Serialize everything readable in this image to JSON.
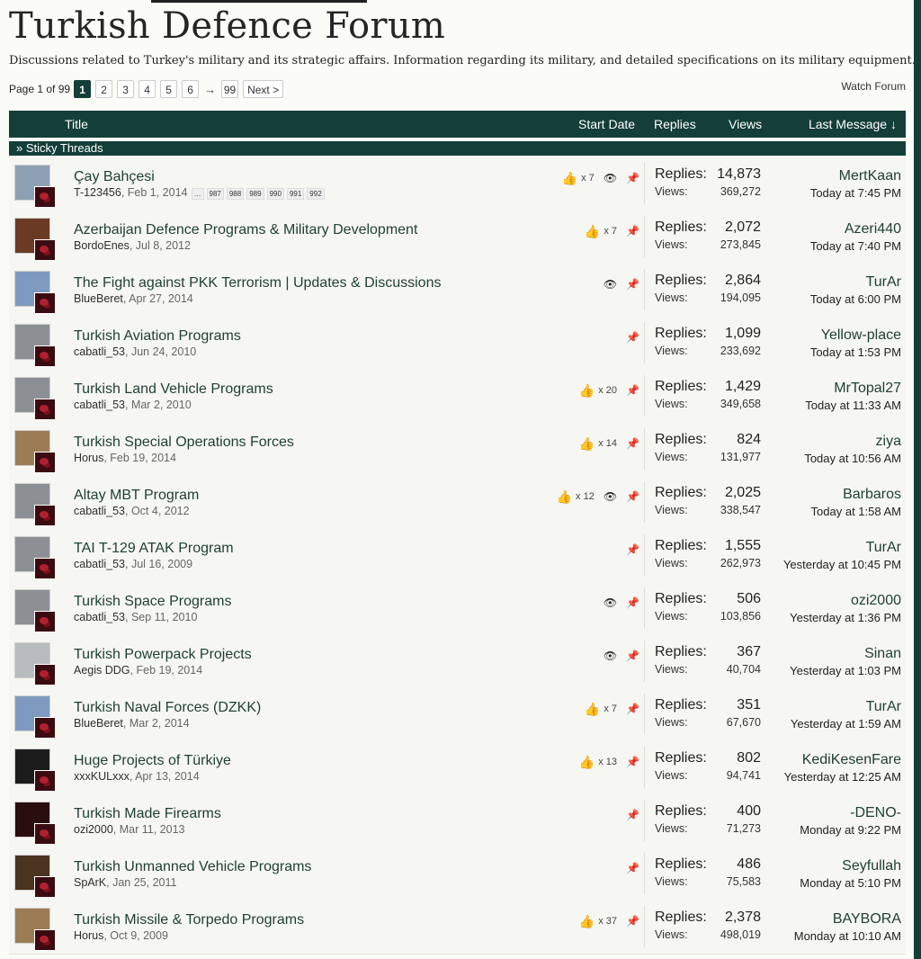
{
  "forum": {
    "title": "Turkish Defence Forum",
    "description": "Discussions related to Turkey's military and its strategic affairs. Information regarding its military, and detailed specifications on its military equipment."
  },
  "pagination": {
    "label": "Page 1 of 99",
    "current": "1",
    "pages": [
      "2",
      "3",
      "4",
      "5",
      "6"
    ],
    "arrow": "→",
    "last": "99",
    "next": "Next >"
  },
  "watch_label": "Watch Forum",
  "columns": {
    "title": "Title",
    "start_date": "Start Date",
    "replies": "Replies",
    "views": "Views",
    "last_message": "Last Message ↓"
  },
  "sticky_label": "» Sticky Threads",
  "row_labels": {
    "replies": "Replies:",
    "views": "Views:"
  },
  "colors": {
    "header": "#143f38",
    "title_link": "#1e3f35",
    "like": "#d49a4c"
  },
  "threads": [
    {
      "title": "Çay Bahçesi",
      "author": "T-123456",
      "date": ", Feb 1, 2014",
      "pages": [
        "…",
        "987",
        "988",
        "989",
        "990",
        "991",
        "992"
      ],
      "likes": "x 7",
      "watched": true,
      "sticky": true,
      "replies": "14,873",
      "views": "369,272",
      "last_user": "MertKaan",
      "last_time": "Today at 7:45 PM",
      "avatar_color": "#8ea0b3"
    },
    {
      "title": "Azerbaijan Defence Programs & Military Development",
      "author": "BordoEnes",
      "date": ", Jul 8, 2012",
      "likes": "x 7",
      "watched": false,
      "sticky": true,
      "replies": "2,072",
      "views": "273,845",
      "last_user": "Azeri440",
      "last_time": "Today at 7:40 PM",
      "avatar_color": "#6b3a25"
    },
    {
      "title": "The Fight against PKK Terrorism | Updates & Discussions",
      "author": "BlueBeret",
      "date": ", Apr 27, 2014",
      "likes": "",
      "watched": true,
      "sticky": true,
      "replies": "2,864",
      "views": "194,095",
      "last_user": "TurAr",
      "last_time": "Today at 6:00 PM",
      "avatar_color": "#7e9bbf"
    },
    {
      "title": "Turkish Aviation Programs",
      "author": "cabatli_53",
      "date": ", Jun 24, 2010",
      "likes": "",
      "watched": false,
      "sticky": true,
      "replies": "1,099",
      "views": "233,692",
      "last_user": "Yellow-place",
      "last_time": "Today at 1:53 PM",
      "avatar_color": "#8c8f94"
    },
    {
      "title": "Turkish Land Vehicle Programs",
      "author": "cabatli_53",
      "date": ", Mar 2, 2010",
      "likes": "x 20",
      "watched": false,
      "sticky": true,
      "replies": "1,429",
      "views": "349,658",
      "last_user": "MrTopal27",
      "last_time": "Today at 11:33 AM",
      "avatar_color": "#8c8f94"
    },
    {
      "title": "Turkish Special Operations Forces",
      "author": "Horus",
      "date": ", Feb 19, 2014",
      "likes": "x 14",
      "watched": false,
      "sticky": true,
      "replies": "824",
      "views": "131,977",
      "last_user": "ziya",
      "last_time": "Today at 10:56 AM",
      "avatar_color": "#9c7c55"
    },
    {
      "title": "Altay MBT Program",
      "author": "cabatli_53",
      "date": ", Oct 4, 2012",
      "likes": "x 12",
      "watched": true,
      "sticky": true,
      "replies": "2,025",
      "views": "338,547",
      "last_user": "Barbaros",
      "last_time": "Today at 1:58 AM",
      "avatar_color": "#8c8f94"
    },
    {
      "title": "TAI T-129 ATAK Program",
      "author": "cabatli_53",
      "date": ", Jul 16, 2009",
      "likes": "",
      "watched": false,
      "sticky": true,
      "replies": "1,555",
      "views": "262,973",
      "last_user": "TurAr",
      "last_time": "Yesterday at 10:45 PM",
      "avatar_color": "#8c8f94"
    },
    {
      "title": "Turkish Space Programs",
      "author": "cabatli_53",
      "date": ", Sep 11, 2010",
      "likes": "",
      "watched": true,
      "sticky": true,
      "replies": "506",
      "views": "103,856",
      "last_user": "ozi2000",
      "last_time": "Yesterday at 1:36 PM",
      "avatar_color": "#8c8f94"
    },
    {
      "title": "Turkish Powerpack Projects",
      "author": "Aegis DDG",
      "date": ", Feb 19, 2014",
      "likes": "",
      "watched": true,
      "sticky": true,
      "replies": "367",
      "views": "40,704",
      "last_user": "Sinan",
      "last_time": "Yesterday at 1:03 PM",
      "avatar_color": "#b8bcbe"
    },
    {
      "title": "Turkish Naval Forces (DZKK)",
      "author": "BlueBeret",
      "date": ", Mar 2, 2014",
      "likes": "x 7",
      "watched": false,
      "sticky": true,
      "replies": "351",
      "views": "67,670",
      "last_user": "TurAr",
      "last_time": "Yesterday at 1:59 AM",
      "avatar_color": "#7e9bbf"
    },
    {
      "title": "Huge Projects of Türkiye",
      "author": "xxxKULxxx",
      "date": ", Apr 13, 2014",
      "likes": "x 13",
      "watched": false,
      "sticky": true,
      "replies": "802",
      "views": "94,741",
      "last_user": "KediKesenFare",
      "last_time": "Yesterday at 12:25 AM",
      "avatar_color": "#1c1c1c"
    },
    {
      "title": "Turkish Made Firearms",
      "author": "ozi2000",
      "date": ", Mar 11, 2013",
      "likes": "",
      "watched": false,
      "sticky": true,
      "replies": "400",
      "views": "71,273",
      "last_user": "-DENO-",
      "last_time": "Monday at 9:22 PM",
      "avatar_color": "#2a0d0d"
    },
    {
      "title": "Turkish Unmanned Vehicle Programs",
      "author": "SpArK",
      "date": ", Jan 25, 2011",
      "likes": "",
      "watched": false,
      "sticky": true,
      "replies": "486",
      "views": "75,583",
      "last_user": "Seyfullah",
      "last_time": "Monday at 5:10 PM",
      "avatar_color": "#4a3420"
    },
    {
      "title": "Turkish Missile & Torpedo Programs",
      "author": "Horus",
      "date": ", Oct 9, 2009",
      "likes": "x 37",
      "watched": false,
      "sticky": true,
      "replies": "2,378",
      "views": "498,019",
      "last_user": "BAYBORA",
      "last_time": "Monday at 10:10 AM",
      "avatar_color": "#9c7c55"
    }
  ]
}
